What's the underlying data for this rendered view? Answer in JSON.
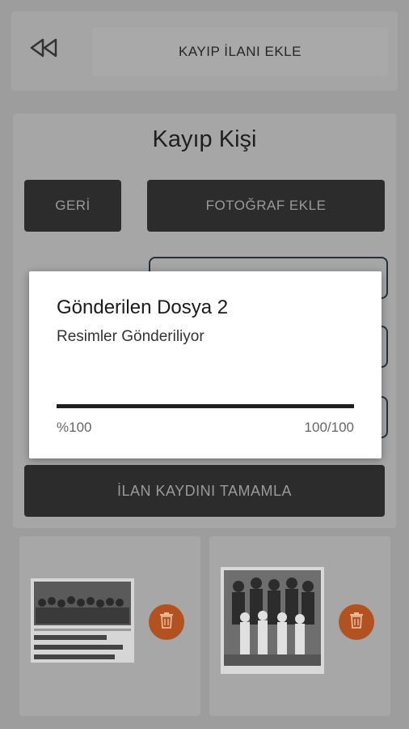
{
  "header": {
    "back_icon": "rewind-back-icon",
    "title": "KAYIP İLANI EKLE"
  },
  "panel": {
    "title": "Kayıp Kişi",
    "back_button": "GERİ",
    "add_photo_button": "FOTOĞRAF EKLE",
    "complete_button": "İLAN KAYDINI TAMAMLA"
  },
  "images": [
    {
      "caption": "Meşhur dolandırıcı cezaevinde yakalandı kanunu bir kadın",
      "delete_icon": "trash-icon"
    },
    {
      "delete_icon": "trash-icon"
    }
  ],
  "dialog": {
    "title": "Gönderilen Dosya 2",
    "message": "Resimler Gönderiliyor",
    "percent_label": "%100",
    "count_label": "100/100",
    "progress": 1.0
  },
  "colors": {
    "dark_button": "#2c2c2c",
    "delete_accent": "#b25221",
    "overlay": "#9d9d9d"
  }
}
